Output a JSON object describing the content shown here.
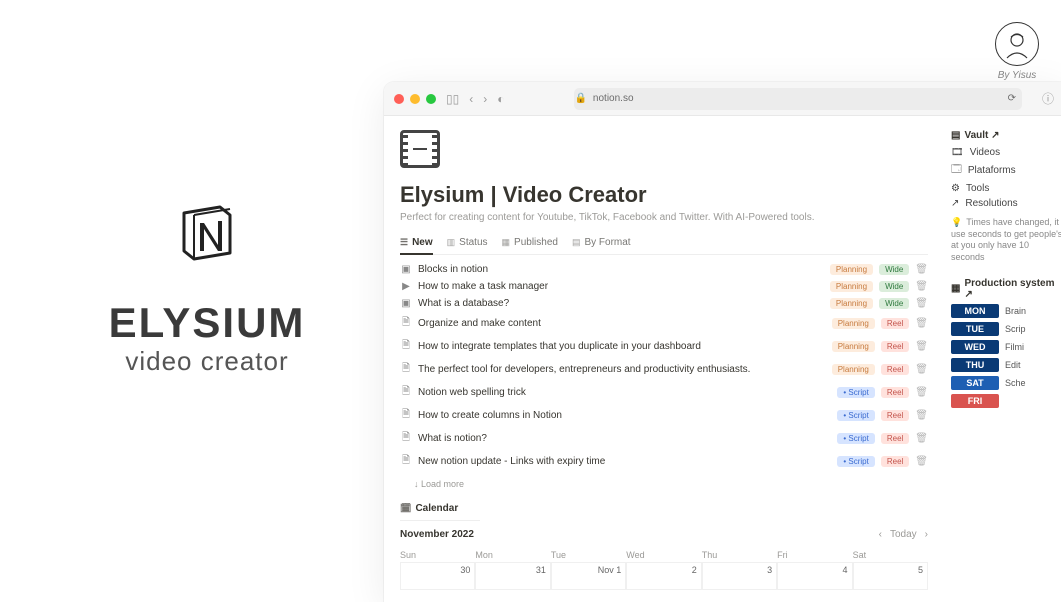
{
  "author": {
    "line": "By Yisus"
  },
  "brand": {
    "title": "ELYSIUM",
    "subtitle": "video creator"
  },
  "browser": {
    "address": "notion.so",
    "lock": "🔒"
  },
  "page": {
    "title": "Elysium | Video Creator",
    "description": "Perfect for creating content for Youtube, TikTok, Facebook and Twitter. With AI-Powered tools."
  },
  "tabs": [
    {
      "label": "New",
      "icon": "☰",
      "active": true
    },
    {
      "label": "Status",
      "icon": "▥",
      "active": false
    },
    {
      "label": "Published",
      "icon": "▦",
      "active": false
    },
    {
      "label": "By Format",
      "icon": "▤",
      "active": false
    }
  ],
  "rows": [
    {
      "icon": "▣",
      "title": "Blocks in notion",
      "status": "Planning",
      "format": "Wide"
    },
    {
      "icon": "▶",
      "title": "How to make a task manager",
      "status": "Planning",
      "format": "Wide"
    },
    {
      "icon": "▣",
      "title": "What is a database?",
      "status": "Planning",
      "format": "Wide"
    },
    {
      "icon": "🗎",
      "title": "Organize and make content",
      "status": "Planning",
      "format": "Reel"
    },
    {
      "icon": "🗎",
      "title": "How to integrate templates that you duplicate in your dashboard",
      "status": "Planning",
      "format": "Reel"
    },
    {
      "icon": "🗎",
      "title": "The perfect tool for developers, entrepreneurs and productivity enthusiasts.",
      "status": "Planning",
      "format": "Reel"
    },
    {
      "icon": "🗎",
      "title": "Notion web spelling trick",
      "status": "Script",
      "format": "Reel"
    },
    {
      "icon": "🗎",
      "title": "How to create columns in Notion",
      "status": "Script",
      "format": "Reel"
    },
    {
      "icon": "🗎",
      "title": "What is notion?",
      "status": "Script",
      "format": "Reel"
    },
    {
      "icon": "🗎",
      "title": "New notion update - Links with expiry time",
      "status": "Script",
      "format": "Reel"
    }
  ],
  "loadmore": "Load more",
  "calendar": {
    "tab": "Calendar",
    "month": "November 2022",
    "today": "Today",
    "weekdays": [
      "Sun",
      "Mon",
      "Tue",
      "Wed",
      "Thu",
      "Fri",
      "Sat"
    ],
    "firstrow": [
      "30",
      "31",
      "Nov 1",
      "2",
      "3",
      "4",
      "5"
    ]
  },
  "side": {
    "vault": "Vault ↗",
    "items": [
      {
        "icon": "🎞",
        "label": "Videos"
      },
      {
        "icon": "🗔",
        "label": "Plataforms"
      },
      {
        "icon": "⚙",
        "label": "Tools"
      },
      {
        "icon": "↗",
        "label": "Resolutions"
      }
    ],
    "note": "Times have changed, it use seconds to get people's at you only have 10 seconds",
    "prod_head": "Production system ↗",
    "days": [
      {
        "chip": "MON",
        "cls": "",
        "label": "Brain"
      },
      {
        "chip": "TUE",
        "cls": "",
        "label": "Scrip"
      },
      {
        "chip": "WED",
        "cls": "",
        "label": "Filmi"
      },
      {
        "chip": "THU",
        "cls": "",
        "label": "Edit"
      },
      {
        "chip": "SAT",
        "cls": "sat",
        "label": "Sche"
      },
      {
        "chip": "FRI",
        "cls": "fri",
        "label": ""
      }
    ]
  }
}
